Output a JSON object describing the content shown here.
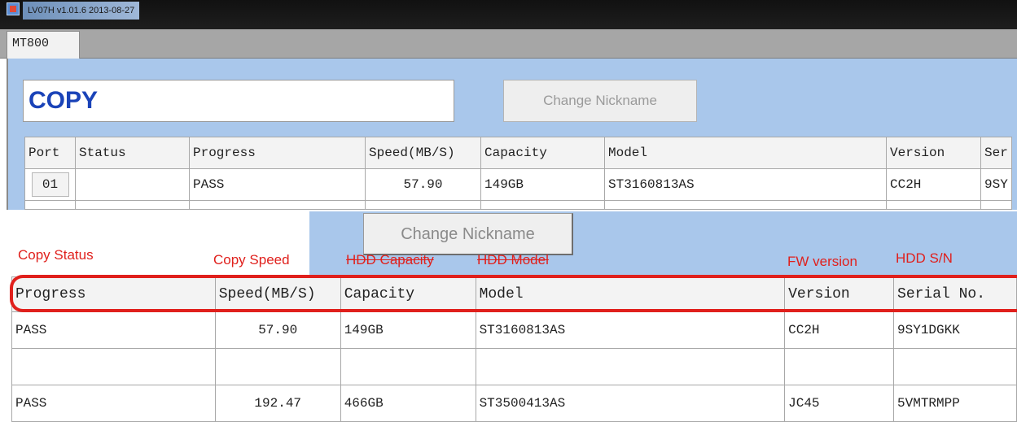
{
  "window": {
    "title": "LV07H v1.01.6 2013-08-27"
  },
  "tab": {
    "label": "MT800"
  },
  "nickname": {
    "value": "COPY"
  },
  "change_nickname_button": {
    "label": "Change Nickname"
  },
  "table_top": {
    "headers": [
      "Port",
      "Status",
      "Progress",
      "Speed(MB/S)",
      "Capacity",
      "Model",
      "Version",
      "Ser"
    ],
    "rows": [
      {
        "port": "01",
        "status": "",
        "progress": "PASS",
        "speed": "57.90",
        "capacity": "149GB",
        "model": "ST3160813AS",
        "version": "CC2H",
        "serial": "9SY"
      }
    ]
  },
  "zoom": {
    "change_nickname_button": {
      "label": "Change Nickname"
    },
    "annotations": {
      "progress": "Copy Status",
      "speed": "Copy Speed",
      "capacity": "HDD Capacity",
      "model": "HDD Model",
      "version": "FW version",
      "serial": "HDD S/N"
    },
    "headers": [
      "Progress",
      "Speed(MB/S)",
      "Capacity",
      "Model",
      "Version",
      "Serial No."
    ],
    "rows": [
      {
        "progress": "PASS",
        "speed": "57.90",
        "capacity": "149GB",
        "model": "ST3160813AS",
        "version": "CC2H",
        "serial": "9SY1DGKK"
      },
      {
        "progress": "",
        "speed": "",
        "capacity": "",
        "model": "",
        "version": "",
        "serial": ""
      },
      {
        "progress": "PASS",
        "speed": "192.47",
        "capacity": "466GB",
        "model": "ST3500413AS",
        "version": "JC45",
        "serial": "5VMTRMPP"
      }
    ]
  },
  "colors": {
    "panel": "#a9c7eb",
    "annotation": "#e0201c",
    "nickname_text": "#1a43b8"
  }
}
